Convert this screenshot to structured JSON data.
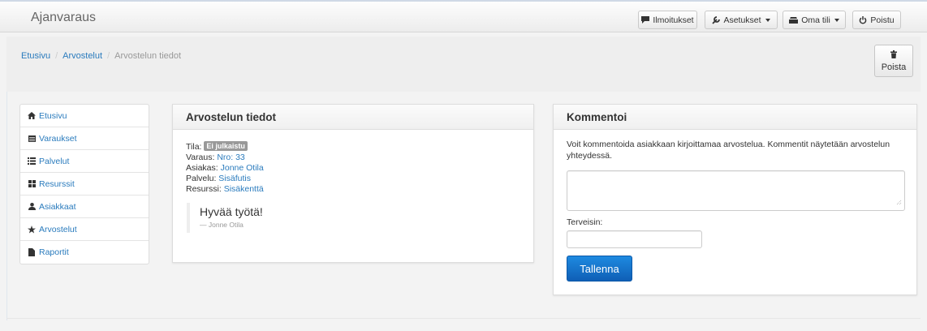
{
  "navbar": {
    "brand": "Ajanvaraus",
    "buttons": [
      {
        "label": "Ilmoitukset",
        "icon": "comment-icon",
        "dropdown": false
      },
      {
        "label": "Asetukset",
        "icon": "wrench-icon",
        "dropdown": true
      },
      {
        "label": "Oma tili",
        "icon": "user-card-icon",
        "dropdown": true
      },
      {
        "label": "Poistu",
        "icon": "power-icon",
        "dropdown": false
      }
    ]
  },
  "breadcrumb": {
    "items": [
      "Etusivu",
      "Arvostelut"
    ],
    "active": "Arvostelun tiedot"
  },
  "delete_button": {
    "label": "Poista",
    "icon": "trash-icon"
  },
  "sidebar": {
    "items": [
      {
        "label": "Etusivu",
        "icon": "home-icon"
      },
      {
        "label": "Varaukset",
        "icon": "calendar-icon"
      },
      {
        "label": "Palvelut",
        "icon": "list-icon"
      },
      {
        "label": "Resurssit",
        "icon": "grid-icon"
      },
      {
        "label": "Asiakkaat",
        "icon": "user-icon"
      },
      {
        "label": "Arvostelut",
        "icon": "star-icon"
      },
      {
        "label": "Raportit",
        "icon": "file-icon"
      }
    ]
  },
  "details": {
    "title": "Arvostelun tiedot",
    "status_label": "Tila:",
    "status_badge": "Ei julkaistu",
    "booking_label": "Varaus:",
    "booking_value": "Nro: 33",
    "customer_label": "Asiakas:",
    "customer_value": "Jonne Otila",
    "service_label": "Palvelu:",
    "service_value": "Sisäfutis",
    "resource_label": "Resurssi:",
    "resource_value": "Sisäkenttä",
    "quote_text": "Hyvää työtä!",
    "quote_author": "— Jonne Otila"
  },
  "comment": {
    "title": "Kommentoi",
    "description": "Voit kommentoida asiakkaan kirjoittamaa arvostelua. Kommentit näytetään arvostelun yhteydessä.",
    "textarea_value": "",
    "greeting_label": "Terveisin:",
    "greeting_value": "",
    "save_label": "Tallenna"
  },
  "colors": {
    "link": "#2a7bbd",
    "primary_button": "#1e8ae0",
    "badge": "#999999"
  }
}
